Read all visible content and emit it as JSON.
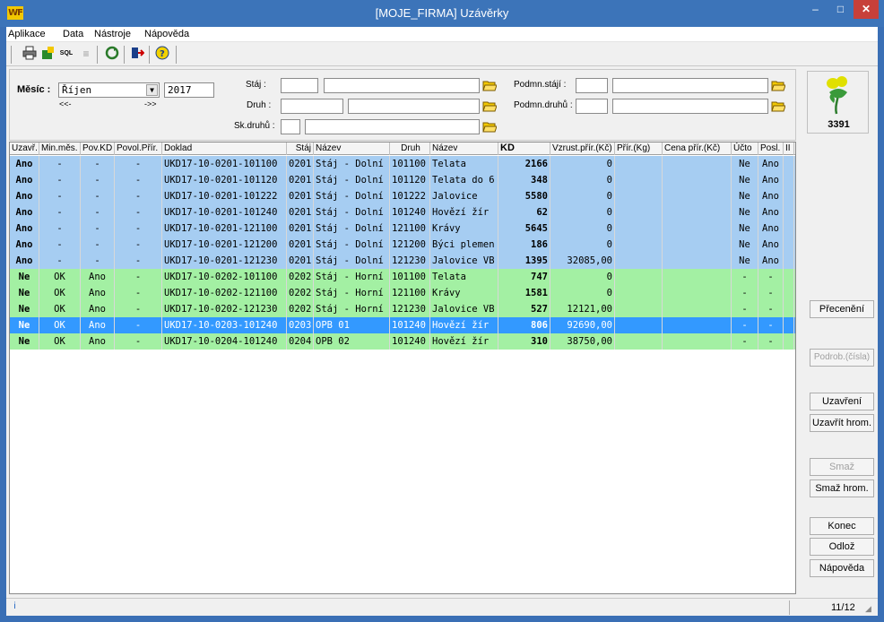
{
  "window": {
    "logo_text": "WF",
    "title": "[MOJE_FIRMA] Uzávěrky",
    "minimize": "–",
    "maximize": "□",
    "close": "✕"
  },
  "menu": [
    "Aplikace",
    "Data",
    "Nástroje",
    "Nápověda"
  ],
  "toolbar_icons": [
    "printer-icon",
    "export-icon",
    "sql-icon",
    "columns-icon",
    "refresh-icon",
    "exit-icon",
    "help-icon"
  ],
  "toolbar_glyphs": {
    "sql": "SQL"
  },
  "form": {
    "month_label": "Měsíc :",
    "month_value": "Říjen",
    "year_value": "2017",
    "prev": "<<-",
    "next": "->>",
    "staj_label": "Stáj :",
    "druh_label": "Druh :",
    "skdruhu_label": "Sk.druhů :",
    "podmn_staji_label": "Podmn.stájí :",
    "podmn_druhu_label": "Podmn.druhů :"
  },
  "columns": [
    "Uzavř.",
    "Min.měs.",
    "Pov.KD",
    "Povol.Přír.",
    "Doklad",
    "Stáj",
    "Název",
    "Druh",
    "Název",
    "KD",
    "Vzrust.přír.(Kč)",
    "Přír.(Kg)",
    "Cena přír.(Kč)",
    "Účto",
    "Posl.",
    "II"
  ],
  "rows": [
    {
      "uzavr": "Ano",
      "min": "-",
      "povkd": "-",
      "povol": "-",
      "doklad": "UKD17-10-0201-101100",
      "staj": "0201",
      "nazev": "Stáj - Dolní",
      "druh": "101100",
      "nazev2": "Telata",
      "kd": "2166",
      "vzrust": "0",
      "prir": "",
      "cena": "",
      "ucto": "Ne",
      "posl": "Ano",
      "color": "blue"
    },
    {
      "uzavr": "Ano",
      "min": "-",
      "povkd": "-",
      "povol": "-",
      "doklad": "UKD17-10-0201-101120",
      "staj": "0201",
      "nazev": "Stáj - Dolní",
      "druh": "101120",
      "nazev2": "Telata do 6",
      "kd": "348",
      "vzrust": "0",
      "prir": "",
      "cena": "",
      "ucto": "Ne",
      "posl": "Ano",
      "color": "blue"
    },
    {
      "uzavr": "Ano",
      "min": "-",
      "povkd": "-",
      "povol": "-",
      "doklad": "UKD17-10-0201-101222",
      "staj": "0201",
      "nazev": "Stáj - Dolní",
      "druh": "101222",
      "nazev2": "Jalovice",
      "kd": "5580",
      "vzrust": "0",
      "prir": "",
      "cena": "",
      "ucto": "Ne",
      "posl": "Ano",
      "color": "blue"
    },
    {
      "uzavr": "Ano",
      "min": "-",
      "povkd": "-",
      "povol": "-",
      "doklad": "UKD17-10-0201-101240",
      "staj": "0201",
      "nazev": "Stáj - Dolní",
      "druh": "101240",
      "nazev2": "Hovězí žír",
      "kd": "62",
      "vzrust": "0",
      "prir": "",
      "cena": "",
      "ucto": "Ne",
      "posl": "Ano",
      "color": "blue"
    },
    {
      "uzavr": "Ano",
      "min": "-",
      "povkd": "-",
      "povol": "-",
      "doklad": "UKD17-10-0201-121100",
      "staj": "0201",
      "nazev": "Stáj - Dolní",
      "druh": "121100",
      "nazev2": "Krávy",
      "kd": "5645",
      "vzrust": "0",
      "prir": "",
      "cena": "",
      "ucto": "Ne",
      "posl": "Ano",
      "color": "blue"
    },
    {
      "uzavr": "Ano",
      "min": "-",
      "povkd": "-",
      "povol": "-",
      "doklad": "UKD17-10-0201-121200",
      "staj": "0201",
      "nazev": "Stáj - Dolní",
      "druh": "121200",
      "nazev2": "Býci plemen",
      "kd": "186",
      "vzrust": "0",
      "prir": "",
      "cena": "",
      "ucto": "Ne",
      "posl": "Ano",
      "color": "blue"
    },
    {
      "uzavr": "Ano",
      "min": "-",
      "povkd": "-",
      "povol": "-",
      "doklad": "UKD17-10-0201-121230",
      "staj": "0201",
      "nazev": "Stáj - Dolní",
      "druh": "121230",
      "nazev2": "Jalovice VB",
      "kd": "1395",
      "vzrust": "32085,00",
      "prir": "",
      "cena": "",
      "ucto": "Ne",
      "posl": "Ano",
      "color": "blue"
    },
    {
      "uzavr": "Ne",
      "min": "OK",
      "povkd": "Ano",
      "povol": "-",
      "doklad": "UKD17-10-0202-101100",
      "staj": "0202",
      "nazev": "Stáj - Horní",
      "druh": "101100",
      "nazev2": "Telata",
      "kd": "747",
      "vzrust": "0",
      "prir": "",
      "cena": "",
      "ucto": "-",
      "posl": "-",
      "color": "green"
    },
    {
      "uzavr": "Ne",
      "min": "OK",
      "povkd": "Ano",
      "povol": "-",
      "doklad": "UKD17-10-0202-121100",
      "staj": "0202",
      "nazev": "Stáj - Horní",
      "druh": "121100",
      "nazev2": "Krávy",
      "kd": "1581",
      "vzrust": "0",
      "prir": "",
      "cena": "",
      "ucto": "-",
      "posl": "-",
      "color": "green"
    },
    {
      "uzavr": "Ne",
      "min": "OK",
      "povkd": "Ano",
      "povol": "-",
      "doklad": "UKD17-10-0202-121230",
      "staj": "0202",
      "nazev": "Stáj - Horní",
      "druh": "121230",
      "nazev2": "Jalovice VB",
      "kd": "527",
      "vzrust": "12121,00",
      "prir": "",
      "cena": "",
      "ucto": "-",
      "posl": "-",
      "color": "green"
    },
    {
      "uzavr": "Ne",
      "min": "OK",
      "povkd": "Ano",
      "povol": "-",
      "doklad": "UKD17-10-0203-101240",
      "staj": "0203",
      "nazev": "OPB 01",
      "druh": "101240",
      "nazev2": "Hovězí žír",
      "kd": "806",
      "vzrust": "92690,00",
      "prir": "",
      "cena": "",
      "ucto": "-",
      "posl": "-",
      "color": "selected"
    },
    {
      "uzavr": "Ne",
      "min": "OK",
      "povkd": "Ano",
      "povol": "-",
      "doklad": "UKD17-10-0204-101240",
      "staj": "0204",
      "nazev": "OPB 02",
      "druh": "101240",
      "nazev2": "Hovězí žír",
      "kd": "310",
      "vzrust": "38750,00",
      "prir": "",
      "cena": "",
      "ucto": "-",
      "posl": "-",
      "color": "green"
    }
  ],
  "row_colors": {
    "blue": "#a6cdf2",
    "green": "#a3f0a3",
    "selected": "#3399ff"
  },
  "side": {
    "logo_number": "3391",
    "preceneni": "Přecenění",
    "podrob": "Podrob.(čísla)",
    "uzavreni": "Uzavření",
    "uzavrit_hrom": "Uzavřít hrom.",
    "smaz": "Smaž",
    "smaz_hrom": "Smaž hrom.",
    "konec": "Konec",
    "odloz": "Odlož",
    "napoveda": "Nápověda"
  },
  "status": {
    "info": "i",
    "count": "11/12"
  }
}
